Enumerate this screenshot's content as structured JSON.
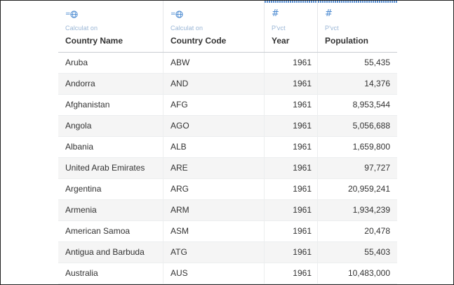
{
  "columns": [
    {
      "icon": "calculated-geo-icon",
      "subtitle": "Calculat on",
      "title": "Country Name"
    },
    {
      "icon": "calculated-geo-icon",
      "subtitle": "Calculat on",
      "title": "Country Code"
    },
    {
      "icon": "number-hash-icon",
      "subtitle": "P'vct",
      "title": "Year"
    },
    {
      "icon": "number-hash-icon",
      "subtitle": "P'vct",
      "title": "Population"
    }
  ],
  "rows": [
    {
      "name": "Aruba",
      "code": "ABW",
      "year": "1961",
      "population": "55,435"
    },
    {
      "name": "Andorra",
      "code": "AND",
      "year": "1961",
      "population": "14,376"
    },
    {
      "name": "Afghanistan",
      "code": "AFG",
      "year": "1961",
      "population": "8,953,544"
    },
    {
      "name": "Angola",
      "code": "AGO",
      "year": "1961",
      "population": "5,056,688"
    },
    {
      "name": "Albania",
      "code": "ALB",
      "year": "1961",
      "population": "1,659,800"
    },
    {
      "name": "United Arab Emirates",
      "code": "ARE",
      "year": "1961",
      "population": "97,727"
    },
    {
      "name": "Argentina",
      "code": "ARG",
      "year": "1961",
      "population": "20,959,241"
    },
    {
      "name": "Armenia",
      "code": "ARM",
      "year": "1961",
      "population": "1,934,239"
    },
    {
      "name": "American Samoa",
      "code": "ASM",
      "year": "1961",
      "population": "20,478"
    },
    {
      "name": "Antigua and Barbuda",
      "code": "ATG",
      "year": "1961",
      "population": "55,403"
    },
    {
      "name": "Australia",
      "code": "AUS",
      "year": "1961",
      "population": "10,483,000"
    }
  ],
  "colors": {
    "accent": "#4d8bd1",
    "selection": "#5b8fd1",
    "subtitle": "#9ab6d6",
    "row_alt": "#f5f5f5"
  }
}
